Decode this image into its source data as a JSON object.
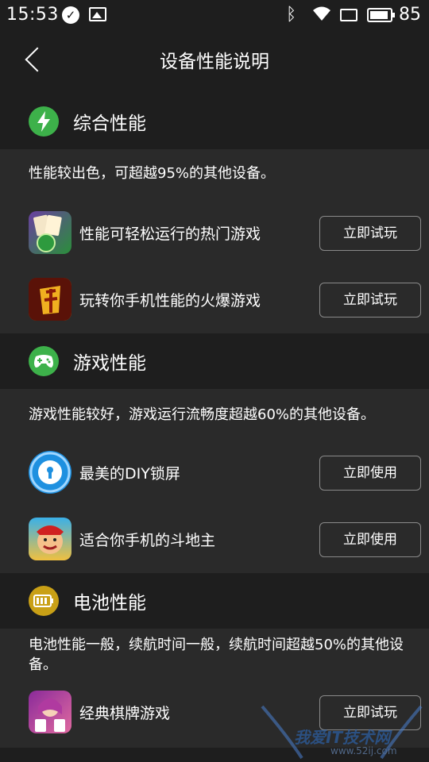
{
  "status_bar": {
    "time": "15:53",
    "battery": "85"
  },
  "header": {
    "title": "设备性能说明"
  },
  "sections": [
    {
      "title": "综合性能",
      "icon": "lightning-icon",
      "color": "#3db14a",
      "description": "性能较出色，可超越95%的其他设备。",
      "items": [
        {
          "label": "性能可轻松运行的热门游戏",
          "button": "立即试玩"
        },
        {
          "label": "玩转你手机性能的火爆游戏",
          "button": "立即试玩"
        }
      ]
    },
    {
      "title": "游戏性能",
      "icon": "gamepad-icon",
      "color": "#3db14a",
      "description": "游戏性能较好，游戏运行流畅度超越60%的其他设备。",
      "items": [
        {
          "label": "最美的DIY锁屏",
          "button": "立即使用"
        },
        {
          "label": "适合你手机的斗地主",
          "button": "立即使用"
        }
      ]
    },
    {
      "title": "电池性能",
      "icon": "battery-icon",
      "color": "#c9a016",
      "description": "电池性能一般，续航时间一般，续航时间超越50%的其他设备。",
      "items": [
        {
          "label": "经典棋牌游戏",
          "button": "立即试玩"
        }
      ]
    }
  ],
  "watermark": {
    "text": "我爱IT技术网",
    "url": "www.52ij.com"
  }
}
